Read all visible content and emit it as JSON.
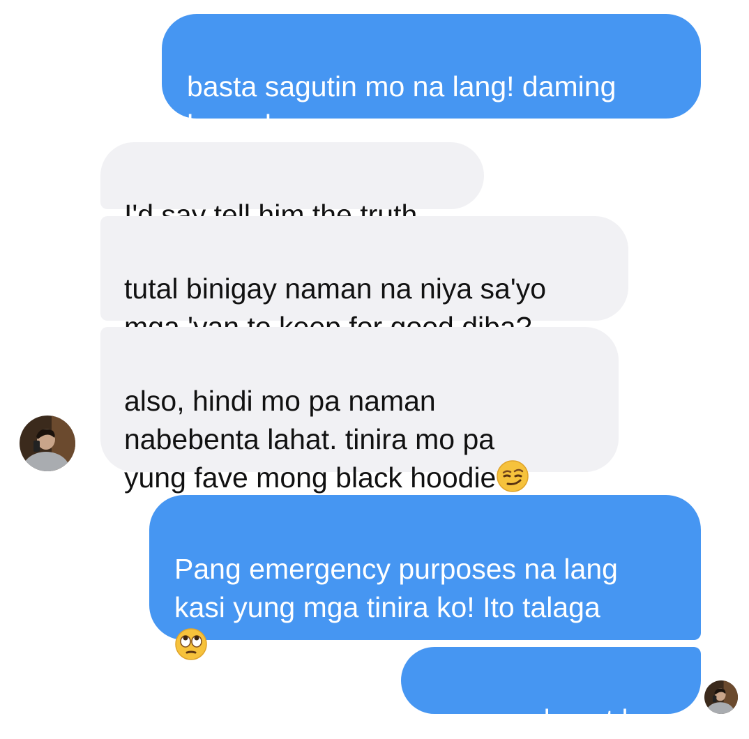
{
  "messages": [
    {
      "direction": "outgoing",
      "text": "basta sagutin mo na lang! daming\nhanash e"
    },
    {
      "direction": "incoming",
      "text": "I'd say tell him the truth"
    },
    {
      "direction": "incoming",
      "text": "tutal binigay naman na niya sa'yo\nmga 'yan to keep for good diba?"
    },
    {
      "direction": "incoming",
      "text": "also, hindi mo pa naman\nnabebenta lahat. tinira mo pa\nyung fave mong black hoodie",
      "trailing_emoji": "smirking-face-emoji"
    },
    {
      "direction": "outgoing",
      "text": "Pang emergency purposes na lang\nkasi yung mga tinira ko! Ito talaga\n",
      "trailing_emoji": "face-with-rolling-eyes-emoji"
    },
    {
      "direction": "outgoing",
      "text": "ge na, salamat ha"
    }
  ],
  "colors": {
    "outgoing_bubble": "#4696f2",
    "incoming_bubble": "#f1f1f4",
    "outgoing_text": "#ffffff",
    "incoming_text": "#111111"
  }
}
